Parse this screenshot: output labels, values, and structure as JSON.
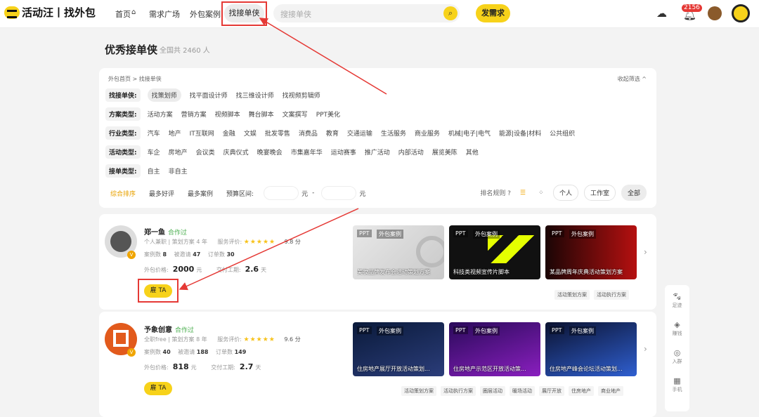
{
  "header": {
    "logo": "活动汪丨找外包",
    "nav": [
      "首页",
      "需求广场",
      "外包案例",
      "找接单侠"
    ],
    "search_placeholder": "搜接单侠",
    "post_label": "发需求",
    "notif_count": "2156"
  },
  "page": {
    "title": "优秀接单侠",
    "subtitle": "全国共 2460 人"
  },
  "filter": {
    "crumb": "外包首页 > 找接单侠",
    "collapse": "收起筛选 ^",
    "rows": [
      {
        "label": "找接单侠:",
        "items": [
          "找策划师",
          "找平面设计师",
          "找三维设计师",
          "找视频剪辑师"
        ]
      },
      {
        "label": "方案类型:",
        "items": [
          "活动方案",
          "营销方案",
          "视频脚本",
          "舞台脚本",
          "文案撰写",
          "PPT美化"
        ]
      },
      {
        "label": "行业类型:",
        "items": [
          "汽车",
          "地产",
          "IT互联网",
          "金融",
          "文娱",
          "批发零售",
          "消费品",
          "教育",
          "交通运输",
          "生活服务",
          "商业服务",
          "机械|电子|电气",
          "能源|设备|材料",
          "公共组织"
        ]
      },
      {
        "label": "活动类型:",
        "items": [
          "车企",
          "房地产",
          "会议类",
          "庆典仪式",
          "晚宴晚会",
          "市集嘉年华",
          "运动赛事",
          "推广活动",
          "内部活动",
          "展览美陈",
          "其他"
        ]
      },
      {
        "label": "接单类型:",
        "items": [
          "自主",
          "非自主"
        ]
      }
    ],
    "sort": [
      "综合排序",
      "最多好评",
      "最多案例"
    ],
    "budget": "预算区间:",
    "yuan": "元",
    "dash": "-",
    "rank": "排名规则 ?",
    "views": [
      "个人",
      "工作室",
      "全部"
    ]
  },
  "providers": [
    {
      "name": "郑一鱼",
      "status": "合作过",
      "role": "个人兼职 | 策划方案 4 年",
      "rating_label": "服务评价:",
      "rating_stars": "★★★★★",
      "rating": "9.8 分",
      "cases": "8",
      "invited": "47",
      "orders": "30",
      "price": "2000",
      "price_unit": "元",
      "delivery": "2.6",
      "delivery_unit": "天",
      "hire": "雇 TA",
      "case_items": [
        {
          "tag": "PPT",
          "tag2": "外包案例",
          "cap": "美妆品牌发布会活动策划方案"
        },
        {
          "tag": "PPT",
          "tag2": "外包案例",
          "cap": "科技类视频宣传片脚本"
        },
        {
          "tag": "PPT",
          "tag2": "外包案例",
          "cap": "某品牌周年庆典活动策划方案"
        }
      ],
      "tags": [
        "活动策划方案",
        "活动执行方案"
      ]
    },
    {
      "name": "予象创意",
      "status": "合作过",
      "role": "全职free | 策划方案 8 年",
      "rating_label": "服务评价:",
      "rating_stars": "★★★★★",
      "rating": "9.6 分",
      "cases": "40",
      "invited": "188",
      "orders": "149",
      "price": "818",
      "price_unit": "元",
      "delivery": "2.7",
      "delivery_unit": "天",
      "hire": "雇 TA",
      "case_items": [
        {
          "tag": "PPT",
          "tag2": "外包案例",
          "cap": "住房地产展厅开放活动策划..."
        },
        {
          "tag": "PPT",
          "tag2": "外包案例",
          "cap": "住房地产示范区开放活动策..."
        },
        {
          "tag": "PPT",
          "tag2": "外包案例",
          "cap": "住房地产峰会论坛活动策划..."
        }
      ],
      "tags": [
        "活动策划方案",
        "活动执行方案",
        "圈层活动",
        "暖场活动",
        "展厅开放",
        "住房地产",
        "商业地产"
      ]
    }
  ],
  "labels": {
    "cases": "案例数",
    "invited": "被邀请",
    "orders": "订单数",
    "price": "外包价格:",
    "delivery": "交付工期:"
  },
  "sidebar": [
    "足迹",
    "赚钱",
    "入群",
    "手机"
  ]
}
